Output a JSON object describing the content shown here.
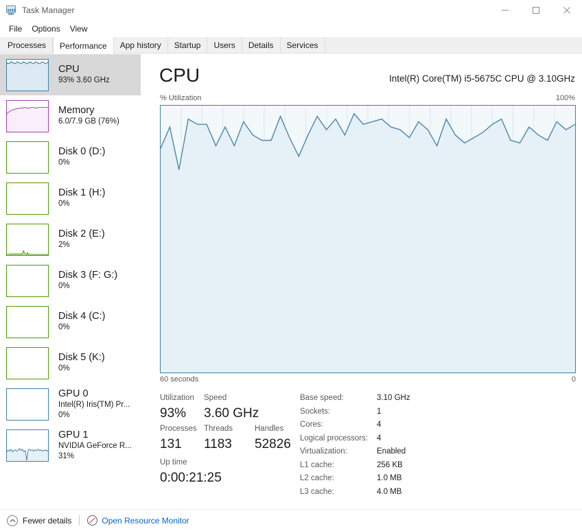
{
  "window": {
    "title": "Task Manager",
    "icon": "task-manager-icon",
    "controls": {
      "minimize": "minimize-icon",
      "maximize": "maximize-icon",
      "close": "close-icon"
    }
  },
  "menu": {
    "items": [
      "File",
      "Options",
      "View"
    ]
  },
  "tabs": [
    {
      "label": "Processes",
      "active": false
    },
    {
      "label": "Performance",
      "active": true
    },
    {
      "label": "App history",
      "active": false
    },
    {
      "label": "Startup",
      "active": false
    },
    {
      "label": "Users",
      "active": false
    },
    {
      "label": "Details",
      "active": false
    },
    {
      "label": "Services",
      "active": false
    }
  ],
  "sidebar": {
    "items": [
      {
        "name": "CPU",
        "sub": "93%  3.60 GHz",
        "sub2": "",
        "selected": true,
        "color": "#3f7fa5",
        "graph": "busy-high"
      },
      {
        "name": "Memory",
        "sub": "6.0/7.9 GB (76%)",
        "sub2": "",
        "selected": false,
        "color": "#a33ea8",
        "graph": "memory"
      },
      {
        "name": "Disk 0 (D:)",
        "sub": "0%",
        "sub2": "",
        "selected": false,
        "color": "#4e9a06",
        "graph": "flat"
      },
      {
        "name": "Disk 1 (H:)",
        "sub": "0%",
        "sub2": "",
        "selected": false,
        "color": "#4e9a06",
        "graph": "flat"
      },
      {
        "name": "Disk 2 (E:)",
        "sub": "2%",
        "sub2": "",
        "selected": false,
        "color": "#4e9a06",
        "graph": "spikes-low"
      },
      {
        "name": "Disk 3 (F: G:)",
        "sub": "0%",
        "sub2": "",
        "selected": false,
        "color": "#4e9a06",
        "graph": "flat"
      },
      {
        "name": "Disk 4 (C:)",
        "sub": "0%",
        "sub2": "",
        "selected": false,
        "color": "#4e9a06",
        "graph": "flat"
      },
      {
        "name": "Disk 5 (K:)",
        "sub": "0%",
        "sub2": "",
        "selected": false,
        "color": "#4e9a06",
        "graph": "flat"
      },
      {
        "name": "GPU 0",
        "sub": "Intel(R) Iris(TM) Pr...",
        "sub2": "0%",
        "selected": false,
        "color": "#3f7fa5",
        "graph": "flat"
      },
      {
        "name": "GPU 1",
        "sub": "NVIDIA GeForce R...",
        "sub2": "31%",
        "selected": false,
        "color": "#3f7fa5",
        "graph": "gpu"
      }
    ]
  },
  "main": {
    "title": "CPU",
    "subtitle": "Intel(R) Core(TM) i5-5675C CPU @ 3.10GHz",
    "axis_top_left": "% Utilization",
    "axis_top_right": "100%",
    "axis_bottom_left": "60 seconds",
    "axis_bottom_right": "0",
    "stats": {
      "utilization_label": "Utilization",
      "utilization_value": "93%",
      "speed_label": "Speed",
      "speed_value": "3.60 GHz",
      "processes_label": "Processes",
      "processes_value": "131",
      "threads_label": "Threads",
      "threads_value": "1183",
      "handles_label": "Handles",
      "handles_value": "52826",
      "uptime_label": "Up time",
      "uptime_value": "0:00:21:25"
    },
    "details": [
      {
        "label": "Base speed:",
        "value": "3.10 GHz"
      },
      {
        "label": "Sockets:",
        "value": "1"
      },
      {
        "label": "Cores:",
        "value": "4"
      },
      {
        "label": "Logical processors:",
        "value": "4"
      },
      {
        "label": "Virtualization:",
        "value": "Enabled"
      },
      {
        "label": "L1 cache:",
        "value": "256 KB"
      },
      {
        "label": "L2 cache:",
        "value": "1.0 MB"
      },
      {
        "label": "L3 cache:",
        "value": "4.0 MB"
      }
    ]
  },
  "statusbar": {
    "fewer_details": "Fewer details",
    "open_resource_monitor": "Open Resource Monitor",
    "link_color": "#0066cc"
  },
  "chart_data": {
    "type": "area",
    "title": "CPU % Utilization",
    "xlabel": "60 seconds",
    "ylabel": "% Utilization",
    "ylim": [
      0,
      100
    ],
    "xlim": [
      60,
      0
    ],
    "grid": true,
    "accent": "#3f7fa5",
    "fill": "#e6f0f7",
    "gridlines_x": 20,
    "gridlines_y": 5,
    "values": [
      84,
      92,
      76,
      95,
      93,
      93,
      85,
      92,
      85,
      94,
      89,
      87,
      87,
      96,
      88,
      81,
      89,
      96,
      91,
      95,
      89,
      97,
      93,
      94,
      95,
      92,
      91,
      88,
      94,
      91,
      85,
      95,
      89,
      86,
      88,
      90,
      93,
      95,
      87,
      86,
      92,
      89,
      87,
      94,
      91,
      93
    ]
  }
}
